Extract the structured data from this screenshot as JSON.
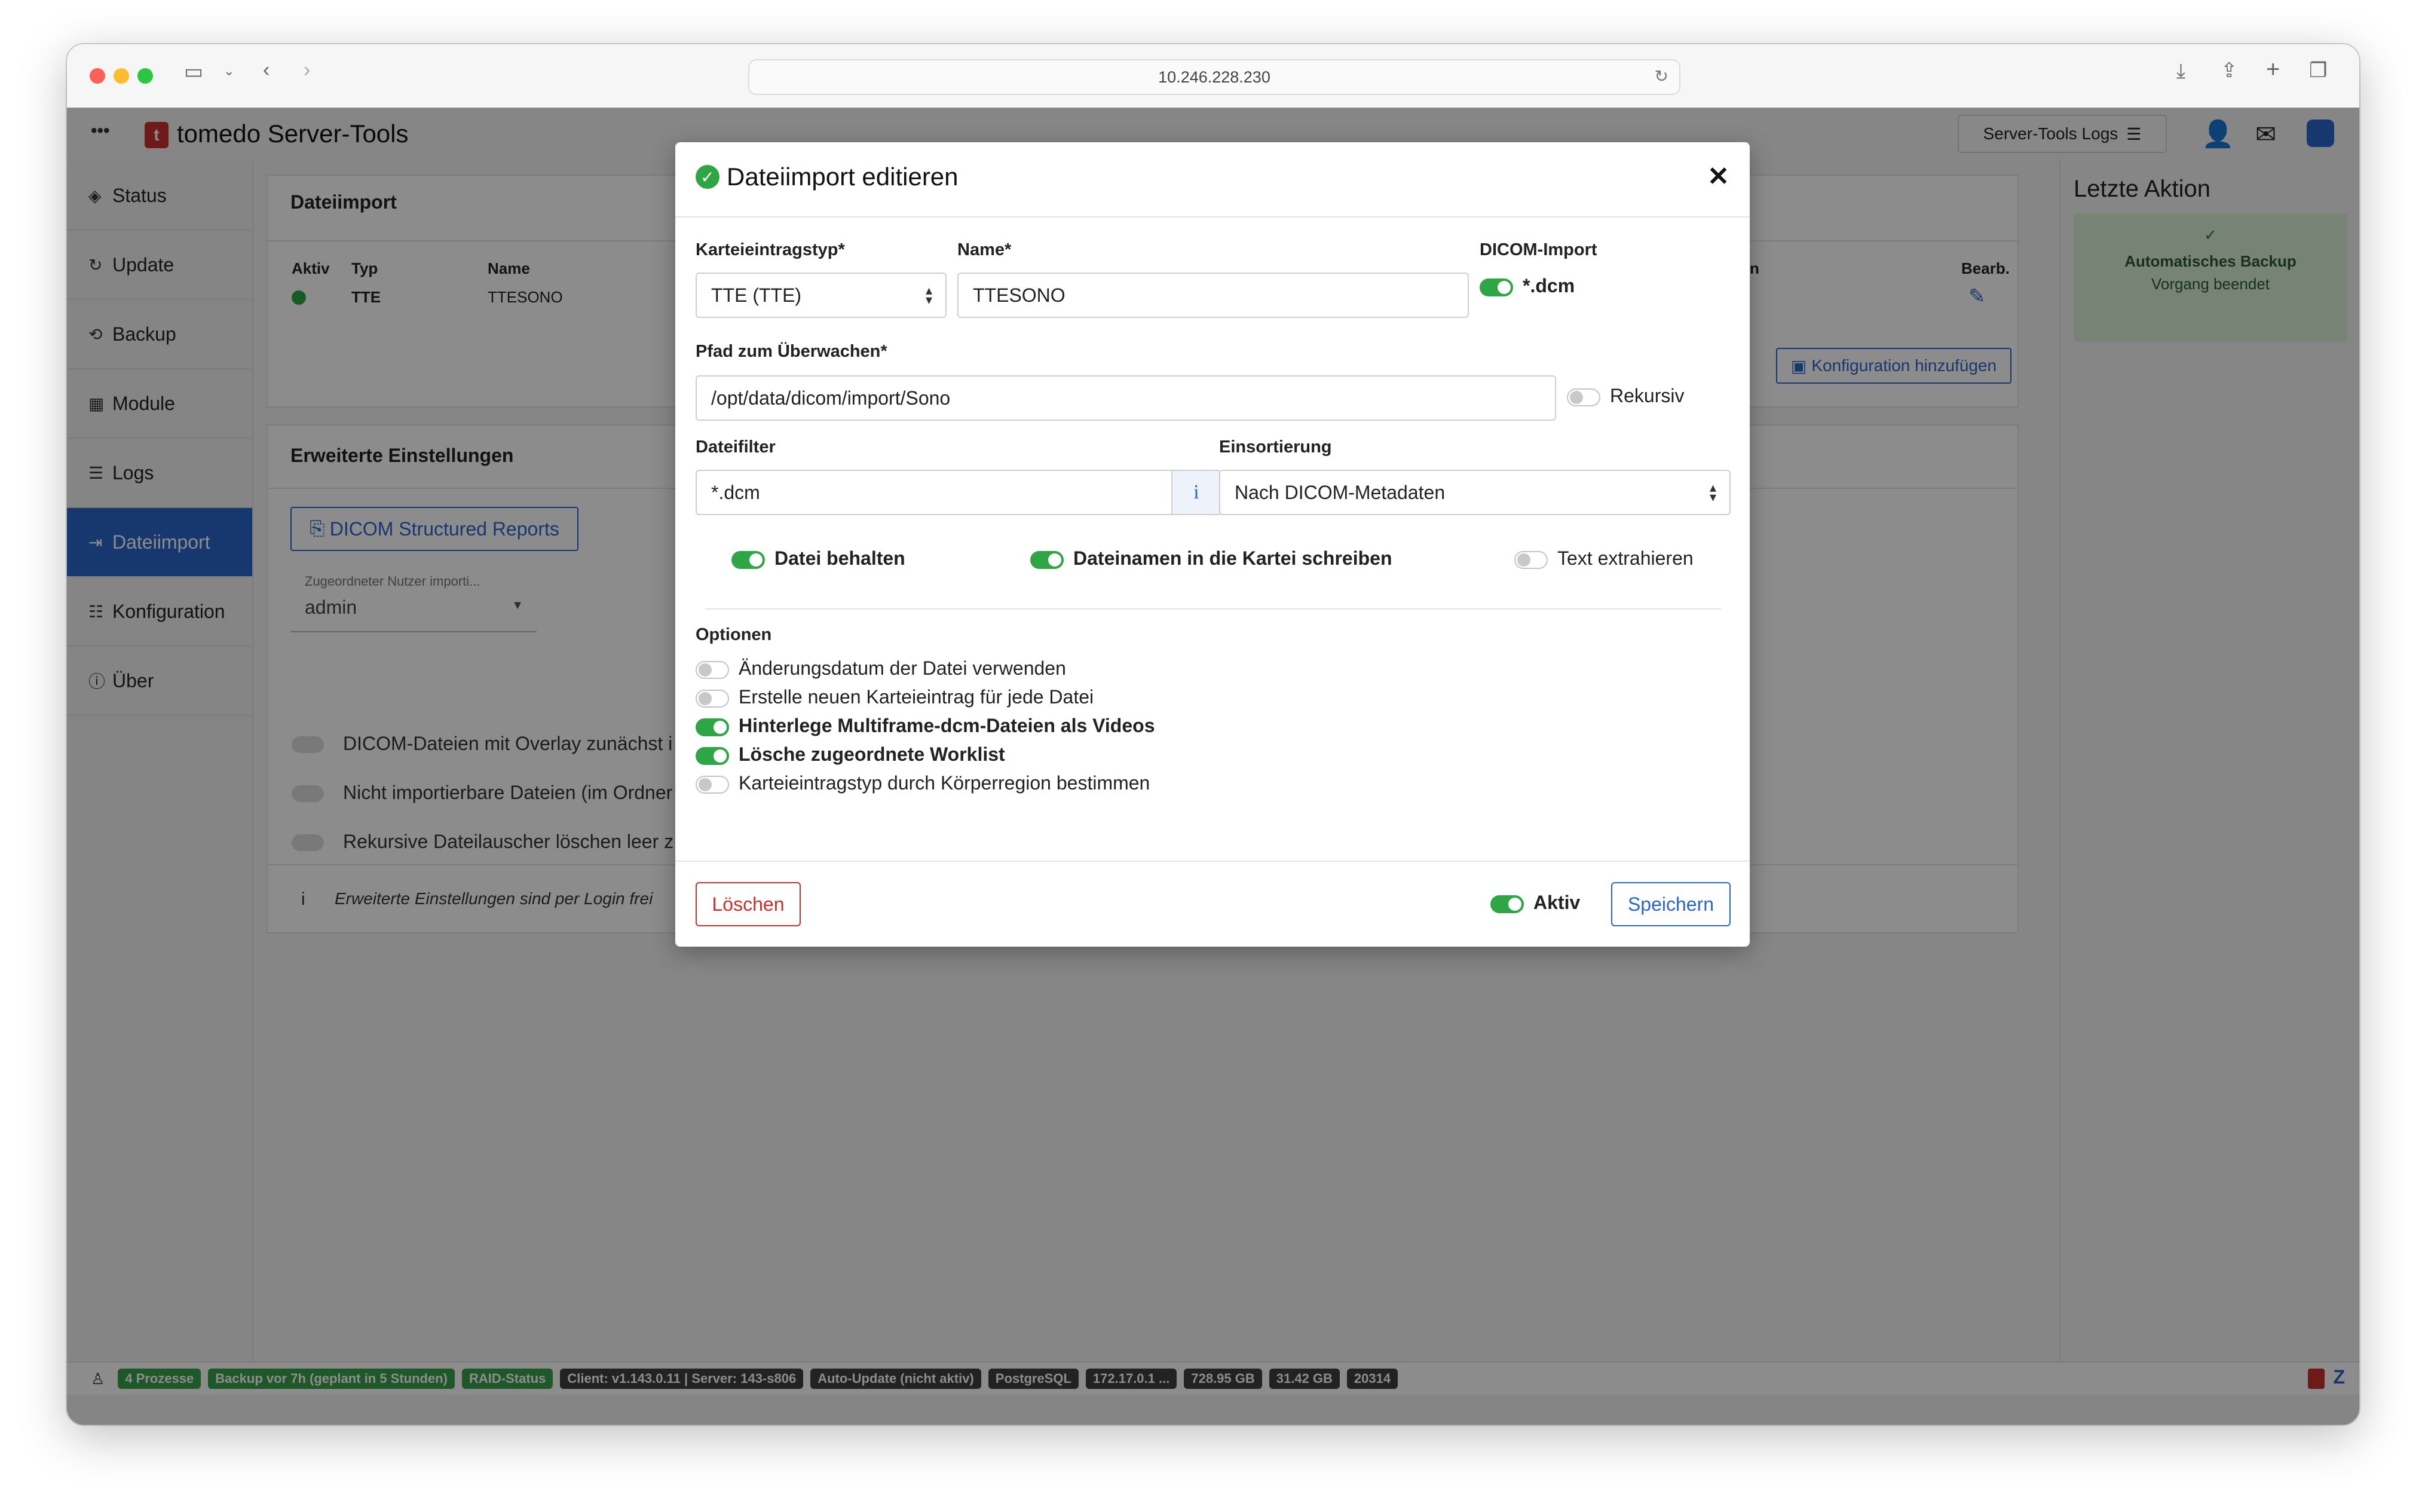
{
  "browser": {
    "url": "10.246.228.230"
  },
  "app": {
    "title": "tomedo Server-Tools",
    "menu_dots": "•••",
    "logs_button": "Server-Tools Logs"
  },
  "sidebar": {
    "items": [
      {
        "label": "Status"
      },
      {
        "label": "Update"
      },
      {
        "label": "Backup"
      },
      {
        "label": "Module"
      },
      {
        "label": "Logs"
      },
      {
        "label": "Dateiimport"
      },
      {
        "label": "Konfiguration"
      },
      {
        "label": "Über"
      }
    ]
  },
  "main": {
    "dateiimport_title": "Dateiimport",
    "table_headers": [
      "Aktiv",
      "Typ",
      "Name",
      "n",
      "Bearb."
    ],
    "row": {
      "typ": "TTE",
      "name": "TTESONO"
    },
    "add_config_button": "Konfiguration hinzufügen",
    "erweitert_title": "Erweiterte Einstellungen",
    "dicom_sr_button": "DICOM Structured Reports",
    "user_select_label": "Zugeordneter Nutzer importi...",
    "user_select_value": "admin",
    "bg_toggles": [
      "DICOM-Dateien mit Overlay zunächst i",
      "Nicht importierbare Dateien (im Ordner",
      "Rekursive Dateilauscher löschen leer z"
    ],
    "info_note": "Erweiterte Einstellungen sind per Login frei"
  },
  "right_panel": {
    "title": "Letzte Aktion",
    "action_title": "Automatisches Backup",
    "action_status": "Vorgang beendet"
  },
  "status_bar": [
    {
      "text": "4 Prozesse",
      "style": "green"
    },
    {
      "text": "Backup vor 7h (geplant in 5 Stunden)",
      "style": "green"
    },
    {
      "text": "RAID-Status",
      "style": "green"
    },
    {
      "text": "Client: v1.143.0.11 | Server: 143-s806",
      "style": "dark"
    },
    {
      "text": "Auto-Update (nicht aktiv)",
      "style": "dark"
    },
    {
      "text": "PostgreSQL",
      "style": "dark"
    },
    {
      "text": "172.17.0.1 ...",
      "style": "dark"
    },
    {
      "text": "728.95 GB",
      "style": "dark"
    },
    {
      "text": "31.42 GB",
      "style": "dark"
    },
    {
      "text": "20314",
      "style": "dark"
    }
  ],
  "modal": {
    "title": "Dateiimport editieren",
    "karteieintragstyp_label": "Karteieintragstyp*",
    "karteieintragstyp_value": "TTE (TTE)",
    "name_label": "Name*",
    "name_value": "TTESONO",
    "dicom_import_label": "DICOM-Import",
    "dicom_toggle_label": "*.dcm",
    "pfad_label": "Pfad zum Überwachen*",
    "pfad_value": "/opt/data/dicom/import/Sono",
    "rekursiv_label": "Rekursiv",
    "dateifilter_label": "Dateifilter",
    "dateifilter_value": "*.dcm",
    "einsortierung_label": "Einsortierung",
    "einsortierung_value": "Nach DICOM-Metadaten",
    "datei_behalten": "Datei behalten",
    "dateinamen": "Dateinamen in die Kartei schreiben",
    "text_extrahieren": "Text extrahieren",
    "optionen_label": "Optionen",
    "options": [
      {
        "label": "Änderungsdatum der Datei verwenden",
        "on": false
      },
      {
        "label": "Erstelle neuen Karteieintrag für jede Datei",
        "on": false
      },
      {
        "label": "Hinterlege Multiframe-dcm-Dateien als Videos",
        "on": true
      },
      {
        "label": "Lösche zugeordnete Worklist",
        "on": true
      },
      {
        "label": "Karteieintragstyp durch Körperregion bestimmen",
        "on": false
      }
    ],
    "delete_button": "Löschen",
    "aktiv_label": "Aktiv",
    "save_button": "Speichern"
  },
  "colors": {
    "accent_blue": "#2a66c9",
    "toggle_green": "#2fa646",
    "delete_red": "#c9302c",
    "status_green": "#3aa14a"
  }
}
